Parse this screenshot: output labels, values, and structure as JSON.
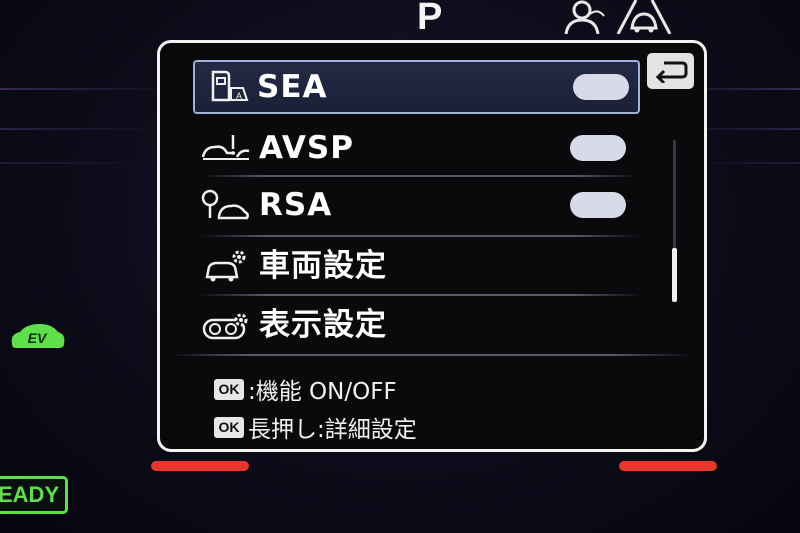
{
  "status_bar": {
    "gear": "P"
  },
  "indicators": {
    "ev": "EV",
    "ready": "EADY"
  },
  "menu": {
    "back_icon": "return-arrow-icon",
    "items": [
      {
        "label": "SEA",
        "icon": "door-exit-alert-icon",
        "toggle": "on",
        "selected": true
      },
      {
        "label": "AVSP",
        "icon": "vehicle-stop-assist-icon",
        "toggle": "on",
        "selected": false
      },
      {
        "label": "RSA",
        "icon": "road-sign-assist-icon",
        "toggle": "on",
        "selected": false
      },
      {
        "label": "車両設定",
        "icon": "vehicle-settings-icon",
        "selected": false
      },
      {
        "label": "表示設定",
        "icon": "display-settings-icon",
        "selected": false
      }
    ]
  },
  "hints": [
    {
      "key": "OK",
      "text": ":機能 ON/OFF"
    },
    {
      "key": "OK",
      "text": "長押し:詳細設定"
    }
  ],
  "colors": {
    "ev_green": "#5ee04a",
    "selection_border": "#9fb3d8",
    "soft_key_red": "#e8372c"
  }
}
